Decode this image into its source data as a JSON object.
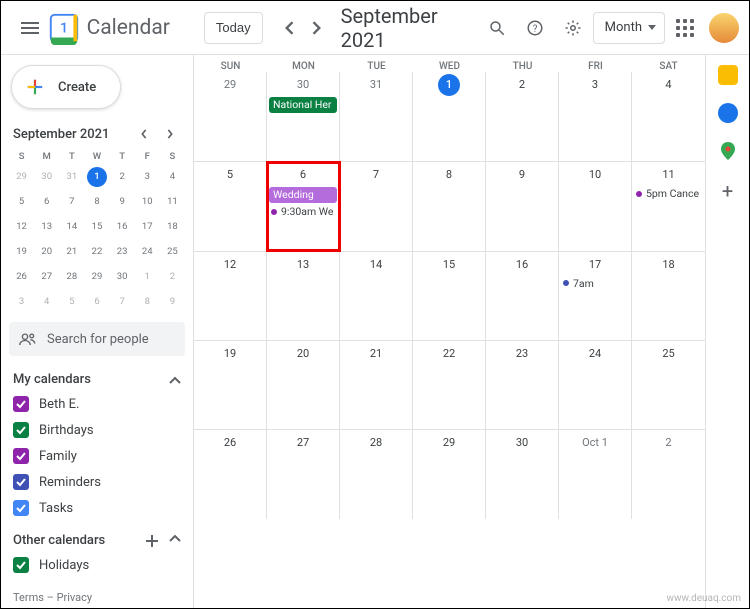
{
  "header": {
    "app_name": "Calendar",
    "today_label": "Today",
    "title": "September 2021",
    "view_label": "Month"
  },
  "sidebar": {
    "create_label": "Create",
    "mini_title": "September 2021",
    "mini_dow": [
      "S",
      "M",
      "T",
      "W",
      "T",
      "F",
      "S"
    ],
    "mini_days": [
      {
        "n": "29",
        "f": true
      },
      {
        "n": "30",
        "f": true
      },
      {
        "n": "31",
        "f": true
      },
      {
        "n": "1",
        "t": true
      },
      {
        "n": "2"
      },
      {
        "n": "3"
      },
      {
        "n": "4"
      },
      {
        "n": "5"
      },
      {
        "n": "6"
      },
      {
        "n": "7"
      },
      {
        "n": "8"
      },
      {
        "n": "9"
      },
      {
        "n": "10"
      },
      {
        "n": "11"
      },
      {
        "n": "12"
      },
      {
        "n": "13"
      },
      {
        "n": "14"
      },
      {
        "n": "15"
      },
      {
        "n": "16"
      },
      {
        "n": "17"
      },
      {
        "n": "18"
      },
      {
        "n": "19"
      },
      {
        "n": "20"
      },
      {
        "n": "21"
      },
      {
        "n": "22"
      },
      {
        "n": "23"
      },
      {
        "n": "24"
      },
      {
        "n": "25"
      },
      {
        "n": "26"
      },
      {
        "n": "27"
      },
      {
        "n": "28"
      },
      {
        "n": "29"
      },
      {
        "n": "30"
      },
      {
        "n": "1",
        "f": true
      },
      {
        "n": "2",
        "f": true
      },
      {
        "n": "3",
        "f": true
      },
      {
        "n": "4",
        "f": true
      },
      {
        "n": "5",
        "f": true
      },
      {
        "n": "6",
        "f": true
      },
      {
        "n": "7",
        "f": true
      },
      {
        "n": "8",
        "f": true
      },
      {
        "n": "9",
        "f": true
      }
    ],
    "search_placeholder": "Search for people",
    "my_cal_label": "My calendars",
    "calendars": [
      {
        "label": "Beth E.",
        "color": "#8e24aa"
      },
      {
        "label": "Birthdays",
        "color": "#0b8043"
      },
      {
        "label": "Family",
        "color": "#8e24aa"
      },
      {
        "label": "Reminders",
        "color": "#3f51b5"
      },
      {
        "label": "Tasks",
        "color": "#4285f4"
      }
    ],
    "other_cal_label": "Other calendars",
    "other_calendars": [
      {
        "label": "Holidays",
        "color": "#0b8043"
      }
    ],
    "footer": "Terms – Privacy"
  },
  "grid": {
    "dow": [
      "SUN",
      "MON",
      "TUE",
      "WED",
      "THU",
      "FRI",
      "SAT"
    ],
    "weeks": [
      [
        {
          "n": "29",
          "fade": true
        },
        {
          "n": "30",
          "fade": true,
          "ev": [
            {
              "type": "chip",
              "cls": "event-green",
              "t": "National Her"
            }
          ]
        },
        {
          "n": "31",
          "fade": true
        },
        {
          "n": "1",
          "today": true
        },
        {
          "n": "2"
        },
        {
          "n": "3"
        },
        {
          "n": "4"
        }
      ],
      [
        {
          "n": "5"
        },
        {
          "n": "6",
          "hl": true,
          "ev": [
            {
              "type": "chip",
              "cls": "event-purple",
              "t": "Wedding"
            },
            {
              "type": "dot",
              "dot": "",
              "t": "9:30am We"
            }
          ]
        },
        {
          "n": "7"
        },
        {
          "n": "8"
        },
        {
          "n": "9"
        },
        {
          "n": "10"
        },
        {
          "n": "11",
          "ev": [
            {
              "type": "dot",
              "dot": "",
              "t": "5pm Cance"
            }
          ]
        }
      ],
      [
        {
          "n": "12"
        },
        {
          "n": "13"
        },
        {
          "n": "14"
        },
        {
          "n": "15"
        },
        {
          "n": "16"
        },
        {
          "n": "17",
          "ev": [
            {
              "type": "dot",
              "dot": "blue",
              "t": "7am"
            }
          ]
        },
        {
          "n": "18"
        }
      ],
      [
        {
          "n": "19"
        },
        {
          "n": "20"
        },
        {
          "n": "21"
        },
        {
          "n": "22"
        },
        {
          "n": "23"
        },
        {
          "n": "24"
        },
        {
          "n": "25"
        }
      ],
      [
        {
          "n": "26"
        },
        {
          "n": "27"
        },
        {
          "n": "28"
        },
        {
          "n": "29"
        },
        {
          "n": "30"
        },
        {
          "n": "Oct 1",
          "fade": true,
          "wide": true
        },
        {
          "n": "2",
          "fade": true
        }
      ],
      [
        {
          "hidden": true
        },
        {
          "hidden": true
        },
        {
          "hidden": true
        },
        {
          "hidden": true
        },
        {
          "hidden": true
        },
        {
          "hidden": true
        },
        {
          "hidden": true
        }
      ]
    ]
  },
  "watermark": "www.deuaq.com"
}
